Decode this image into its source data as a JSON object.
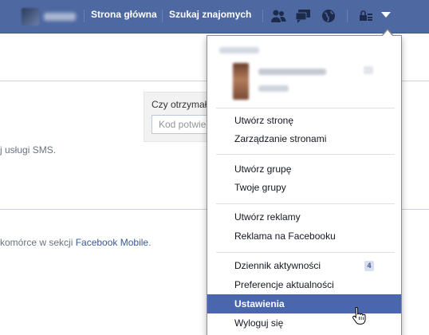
{
  "topbar": {
    "nav": {
      "home_label": "Strona główna",
      "find_friends_label": "Szukaj znajomych"
    },
    "icons": [
      "friend-requests-icon",
      "messages-icon",
      "notifications-icon",
      "privacy-lock-icon",
      "account-menu-chevron-icon"
    ],
    "accent_color": "#4e69a2"
  },
  "content": {
    "sms_question": "Czy otrzymał",
    "code_placeholder": "Kod potwie",
    "sms_text": "j usługi SMS.",
    "mobile_prefix": "komórce w sekcji ",
    "mobile_link": "Facebook Mobile",
    "mobile_suffix": "."
  },
  "menu": {
    "create_page": "Utwórz stronę",
    "manage_pages": "Zarządzanie stronami",
    "create_group": "Utwórz grupę",
    "your_groups": "Twoje grupy",
    "create_ads": "Utwórz reklamy",
    "advertising": "Reklama na Facebooku",
    "activity_log": "Dziennik aktywności",
    "activity_count": "4",
    "news_feed_prefs": "Preferencje aktualności",
    "settings": "Ustawienia",
    "log_out": "Wyloguj się",
    "highlight_color": "#4a67ad"
  }
}
